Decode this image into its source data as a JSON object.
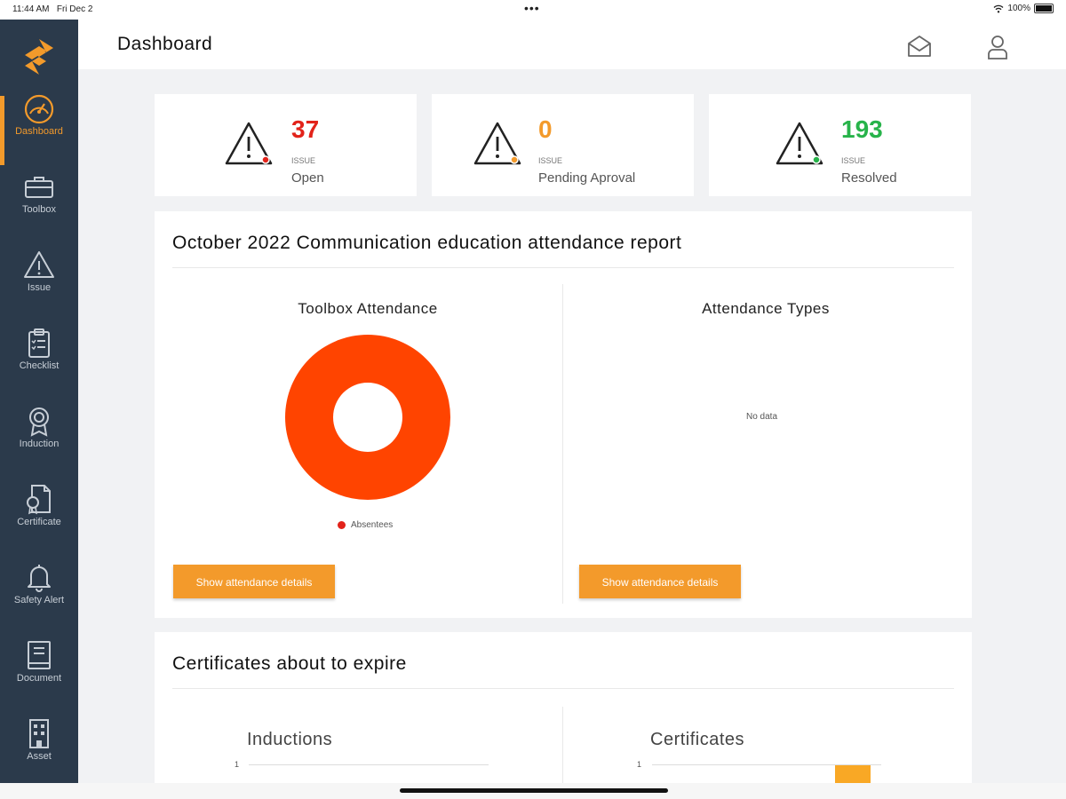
{
  "status_bar": {
    "time": "11:44 AM",
    "date": "Fri Dec 2",
    "battery": "100%"
  },
  "sidebar": {
    "items": [
      {
        "label": "Dashboard",
        "icon": "gauge-icon",
        "active": true
      },
      {
        "label": "Toolbox",
        "icon": "toolbox-icon"
      },
      {
        "label": "Issue",
        "icon": "warning-icon"
      },
      {
        "label": "Checklist",
        "icon": "clipboard-icon"
      },
      {
        "label": "Induction",
        "icon": "award-icon"
      },
      {
        "label": "Certificate",
        "icon": "certificate-icon"
      },
      {
        "label": "Safety Alert",
        "icon": "bell-icon"
      },
      {
        "label": "Document",
        "icon": "book-icon"
      },
      {
        "label": "Asset",
        "icon": "building-icon"
      }
    ]
  },
  "header": {
    "title": "Dashboard",
    "icons": [
      "mail-icon",
      "user-icon"
    ]
  },
  "stats": [
    {
      "value": "37",
      "caption": "ISSUE",
      "label": "Open",
      "color": "#e2231a"
    },
    {
      "value": "0",
      "caption": "ISSUE",
      "label": "Pending Aproval",
      "color": "#f39a2b"
    },
    {
      "value": "193",
      "caption": "ISSUE",
      "label": "Resolved",
      "color": "#27b34a"
    }
  ],
  "attendance": {
    "title": "October 2022 Communication education attendance report",
    "left_title": "Toolbox Attendance",
    "right_title": "Attendance Types",
    "no_data": "No data",
    "button_label": "Show attendance details",
    "legend_label": "Absentees"
  },
  "certificates": {
    "title": "Certificates about to expire",
    "left_title": "Inductions",
    "right_title": "Certificates",
    "tick_label": "1"
  },
  "chart_data": [
    {
      "type": "pie",
      "title": "Toolbox Attendance",
      "categories": [
        "Absentees"
      ],
      "values": [
        1
      ],
      "colors": [
        "#ff4400"
      ],
      "donut": true,
      "legend": "bottom"
    },
    {
      "type": "bar",
      "title": "Certificates",
      "categories": [
        ""
      ],
      "values": [
        1
      ],
      "ylim": [
        0,
        1
      ],
      "colors": [
        "#f9a825"
      ]
    }
  ],
  "colors": {
    "accent": "#f39a2b",
    "sidebar": "#2b3a4b",
    "donut": "#ff4400"
  }
}
